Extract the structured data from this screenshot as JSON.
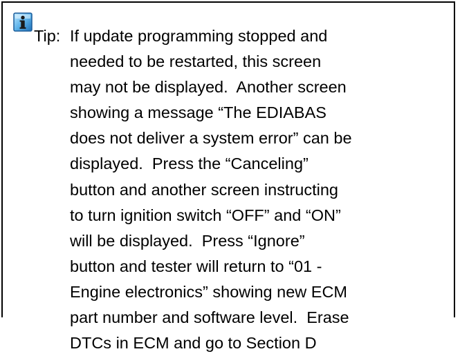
{
  "tip": {
    "icon": "info-icon",
    "label": "Tip:",
    "lines": [
      "If update programming stopped and",
      "needed to be restarted, this screen",
      "may not be displayed.  Another screen",
      "showing a message “The EDIABAS",
      "does not deliver a system error” can be",
      "displayed.  Press the “Canceling”",
      "button and another screen instructing",
      "to turn ignition switch “OFF” and “ON”",
      "will be displayed.  Press “Ignore”",
      "button and tester will return to “01 -",
      "Engine electronics” showing new ECM",
      "part number and software level.  Erase",
      "DTCs in ECM and go to Section D"
    ]
  }
}
